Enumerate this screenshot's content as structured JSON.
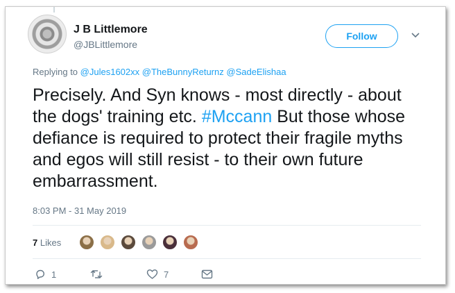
{
  "author": {
    "name": "J B Littlemore",
    "handle": "@JBLittlemore"
  },
  "follow_label": "Follow",
  "reply_to": {
    "prefix": "Replying to",
    "mentions": [
      "@Jules1602xx",
      "@TheBunnyReturnz",
      "@SadeElishaa"
    ]
  },
  "tweet": {
    "text_before": "Precisely. And Syn knows - most directly - about the dogs' training etc. ",
    "hashtag": "#Mccann",
    "text_after": " But those whose defiance is required to protect their fragile myths and egos will still resist - to their own future embarrassment."
  },
  "timestamp": "8:03 PM - 31 May 2019",
  "likes": {
    "count": "7",
    "label": "Likes",
    "avatar_colors": [
      "#8b6f47",
      "#d9b98a",
      "#5b4a3c",
      "#9a9a9a",
      "#4a2f3a",
      "#b86b4f"
    ]
  },
  "actions": {
    "reply_count": "1",
    "retweet_count": "",
    "like_count": "7"
  },
  "colors": {
    "accent": "#1da1f2",
    "text": "#14171a",
    "muted": "#657786"
  }
}
